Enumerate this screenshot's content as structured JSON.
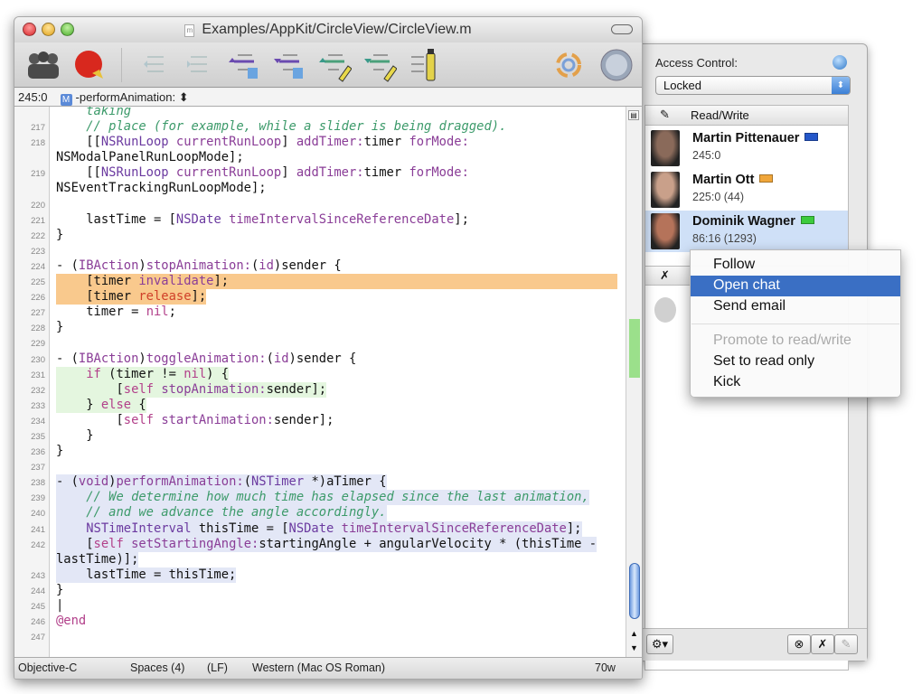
{
  "window": {
    "title": "Examples/AppKit/CircleView/CircleView.m",
    "doc_icon_letter": "m"
  },
  "toolbar": {
    "icons": [
      "participants-icon",
      "seesaw-icon",
      "previous-change-icon",
      "next-change-icon",
      "previous-symbol-icon",
      "next-symbol-icon",
      "previous-highlight-icon",
      "next-highlight-icon",
      "highlighter-icon",
      "sync-icon",
      "internet-icon"
    ]
  },
  "navbar": {
    "position": "245:0",
    "symbol_badge": "M",
    "symbol": "-performAnimation:",
    "symbol_arrows": "⬍"
  },
  "code": [
    {
      "n": "",
      "seg": [
        [
          "    ",
          "",
          ""
        ],
        [
          "taking",
          "cm"
        ]
      ]
    },
    {
      "n": "217",
      "seg": [
        [
          "    "
        ],
        [
          "// place (for example, while a slider is being dragged).",
          "cm"
        ]
      ]
    },
    {
      "n": "218",
      "seg": [
        [
          "    [["
        ],
        [
          "NSRunLoop",
          "cls"
        ],
        [
          " "
        ],
        [
          "currentRunLoop",
          "msg"
        ],
        [
          "] "
        ],
        [
          "addTimer:",
          "msg"
        ],
        [
          "timer "
        ],
        [
          "forMode:",
          "msg"
        ]
      ]
    },
    {
      "n": "",
      "seg": [
        [
          "NSModalPanelRunLoopMode];"
        ]
      ]
    },
    {
      "n": "219",
      "seg": [
        [
          "    [["
        ],
        [
          "NSRunLoop",
          "cls"
        ],
        [
          " "
        ],
        [
          "currentRunLoop",
          "msg"
        ],
        [
          "] "
        ],
        [
          "addTimer:",
          "msg"
        ],
        [
          "timer "
        ],
        [
          "forMode:",
          "msg"
        ]
      ]
    },
    {
      "n": "",
      "seg": [
        [
          "NSEventTrackingRunLoopMode];"
        ]
      ]
    },
    {
      "n": "220",
      "seg": []
    },
    {
      "n": "221",
      "seg": [
        [
          "    lastTime = ["
        ],
        [
          "NSDate",
          "cls"
        ],
        [
          " "
        ],
        [
          "timeIntervalSinceReferenceDate",
          "msg"
        ],
        [
          "];"
        ]
      ]
    },
    {
      "n": "222",
      "seg": [
        [
          "}"
        ]
      ]
    },
    {
      "n": "223",
      "seg": []
    },
    {
      "n": "224",
      "seg": [
        [
          "- ("
        ],
        [
          "IBAction",
          "msg"
        ],
        [
          ")"
        ],
        [
          "stopAnimation:",
          "msg"
        ],
        [
          "("
        ],
        [
          "id",
          "msg"
        ],
        [
          ")sender {"
        ]
      ]
    },
    {
      "n": "225",
      "hl": "orange-full",
      "seg": [
        [
          "    [timer "
        ],
        [
          "invalidate",
          "msg"
        ],
        [
          "];"
        ]
      ]
    },
    {
      "n": "226",
      "hl": "orange",
      "seg": [
        [
          "    [timer "
        ],
        [
          "release",
          "rel"
        ],
        [
          "];"
        ]
      ]
    },
    {
      "n": "227",
      "seg": [
        [
          "    timer = "
        ],
        [
          "nil",
          "kw"
        ],
        [
          ";"
        ]
      ]
    },
    {
      "n": "228",
      "seg": [
        [
          "}"
        ]
      ]
    },
    {
      "n": "229",
      "seg": []
    },
    {
      "n": "230",
      "seg": [
        [
          "- ("
        ],
        [
          "IBAction",
          "msg"
        ],
        [
          ")"
        ],
        [
          "toggleAnimation:",
          "msg"
        ],
        [
          "("
        ],
        [
          "id",
          "msg"
        ],
        [
          ")sender {"
        ]
      ]
    },
    {
      "n": "231",
      "hl": "green",
      "seg": [
        [
          "    "
        ],
        [
          "if",
          "kw"
        ],
        [
          " (timer != "
        ],
        [
          "nil",
          "kw"
        ],
        [
          ") {"
        ]
      ]
    },
    {
      "n": "232",
      "hl": "green",
      "seg": [
        [
          "        ["
        ],
        [
          "self",
          "kw"
        ],
        [
          " "
        ],
        [
          "stopAnimation:",
          "msg"
        ],
        [
          "sender];"
        ]
      ]
    },
    {
      "n": "233",
      "hl": "green",
      "seg": [
        [
          "    } "
        ],
        [
          "else",
          "kw"
        ],
        [
          " {"
        ]
      ]
    },
    {
      "n": "234",
      "seg": [
        [
          "        ["
        ],
        [
          "self",
          "kw"
        ],
        [
          " "
        ],
        [
          "startAnimation:",
          "msg"
        ],
        [
          "sender];"
        ]
      ]
    },
    {
      "n": "235",
      "seg": [
        [
          "    }"
        ]
      ]
    },
    {
      "n": "236",
      "seg": [
        [
          "}"
        ]
      ]
    },
    {
      "n": "237",
      "seg": []
    },
    {
      "n": "238",
      "hl": "blue",
      "seg": [
        [
          "- ("
        ],
        [
          "void",
          "msg"
        ],
        [
          ")"
        ],
        [
          "performAnimation:",
          "msg"
        ],
        [
          "("
        ],
        [
          "NSTimer",
          "cls"
        ],
        [
          " *)aTimer {"
        ]
      ]
    },
    {
      "n": "239",
      "hl": "blue",
      "seg": [
        [
          "    "
        ],
        [
          "// We determine how much time has elapsed since the last animation,",
          "cm"
        ]
      ]
    },
    {
      "n": "240",
      "hl": "blue",
      "seg": [
        [
          "    "
        ],
        [
          "// and we advance the angle accordingly.",
          "cm"
        ]
      ]
    },
    {
      "n": "241",
      "hl": "blue",
      "seg": [
        [
          "    "
        ],
        [
          "NSTimeInterval",
          "cls"
        ],
        [
          " thisTime = ["
        ],
        [
          "NSDate",
          "cls"
        ],
        [
          " "
        ],
        [
          "timeIntervalSinceReferenceDate",
          "msg"
        ],
        [
          "];"
        ]
      ]
    },
    {
      "n": "242",
      "hl": "blue",
      "seg": [
        [
          "    ["
        ],
        [
          "self",
          "kw"
        ],
        [
          " "
        ],
        [
          "setStartingAngle:",
          "msg"
        ],
        [
          "startingAngle + angularVelocity * (thisTime -"
        ]
      ]
    },
    {
      "n": "",
      "hl": "blue",
      "seg": [
        [
          "lastTime)];"
        ]
      ]
    },
    {
      "n": "243",
      "hl": "blue",
      "seg": [
        [
          "    lastTime = thisTime;"
        ]
      ]
    },
    {
      "n": "244",
      "seg": [
        [
          "}"
        ]
      ]
    },
    {
      "n": "245",
      "seg": [
        [
          "|"
        ]
      ]
    },
    {
      "n": "246",
      "seg": [
        [
          "@end",
          "kw"
        ]
      ]
    },
    {
      "n": "247",
      "seg": []
    }
  ],
  "status": {
    "language": "Objective-C",
    "tabs": "Spaces (4)",
    "line_endings": "(LF)",
    "encoding": "Western (Mac OS Roman)",
    "width": "70w"
  },
  "drawer": {
    "access_label": "Access Control:",
    "access_value": "Locked",
    "section_header": "Read/Write",
    "users": [
      {
        "name": "Martin Pittenauer",
        "position": "245:0",
        "color": "#2457c9",
        "selected": false
      },
      {
        "name": "Martin Ott",
        "position": "225:0 (44)",
        "color": "#f0a63a",
        "selected": false
      },
      {
        "name": "Dominik Wagner",
        "position": "86:16 (1293)",
        "color": "#3ccb3c",
        "selected": true
      }
    ],
    "bottom_icons": [
      "gear-icon",
      "kick-icon",
      "read-only-icon",
      "read-write-icon"
    ]
  },
  "context_menu": {
    "items": [
      {
        "label": "Follow",
        "state": "normal"
      },
      {
        "label": "Open chat",
        "state": "highlighted"
      },
      {
        "label": "Send email",
        "state": "normal"
      },
      {
        "label": "Promote to read/write",
        "state": "disabled"
      },
      {
        "label": "Set to read only",
        "state": "normal"
      },
      {
        "label": "Kick",
        "state": "normal"
      }
    ]
  }
}
